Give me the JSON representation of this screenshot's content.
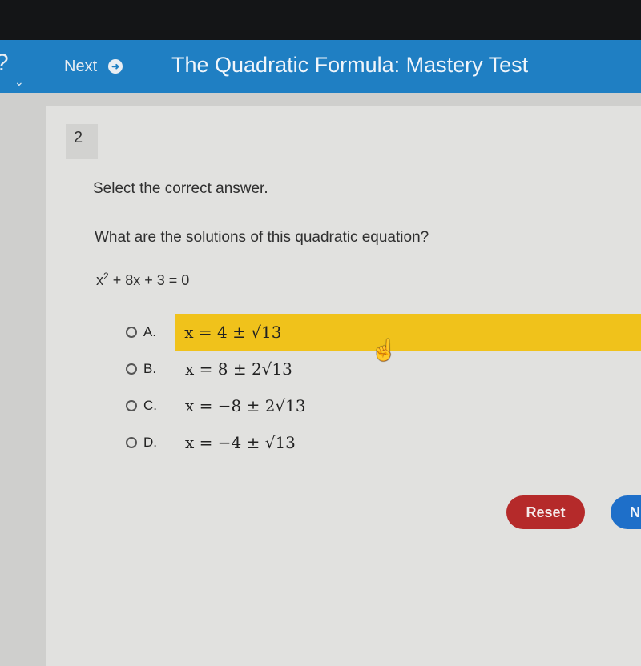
{
  "header": {
    "next_label": "Next",
    "next_icon": "arrow-circle-right-icon",
    "title": "The Quadratic Formula: Mastery Test"
  },
  "question": {
    "number": "2",
    "instruction": "Select the correct answer.",
    "prompt": "What are the solutions of this quadratic equation?",
    "equation_base": "x",
    "equation_exp": "2",
    "equation_rest": " + 8x + 3 = 0",
    "options": [
      {
        "letter": "A.",
        "text": "x = 4 ± √13",
        "highlighted": true
      },
      {
        "letter": "B.",
        "text": "x = 8 ± 2√13",
        "highlighted": false
      },
      {
        "letter": "C.",
        "text": "x = −8 ± 2√13",
        "highlighted": false
      },
      {
        "letter": "D.",
        "text": "x = −4 ± √13",
        "highlighted": false
      }
    ]
  },
  "buttons": {
    "reset": "Reset",
    "next_partial": "N"
  },
  "colors": {
    "header": "#1f7fc3",
    "highlight": "#f0c21b",
    "reset": "#b52a2a",
    "next": "#1e6fc9"
  }
}
